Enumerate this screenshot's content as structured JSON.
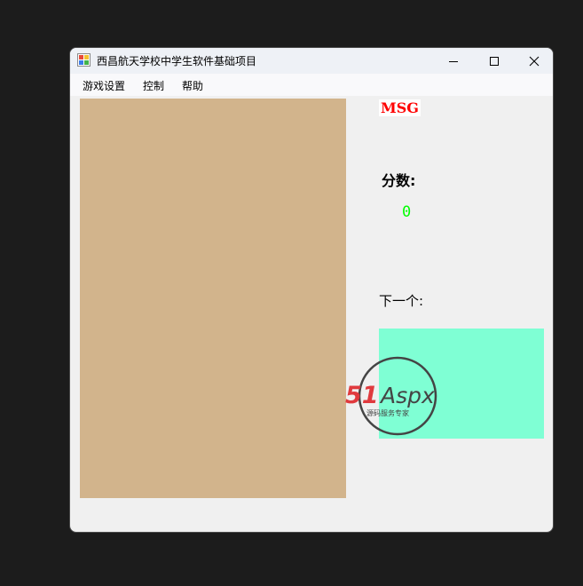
{
  "window": {
    "title": "西昌航天学校中学生软件基础项目",
    "icon": "app-icon",
    "controls": [
      "minimize-icon",
      "maximize-icon",
      "close-icon"
    ]
  },
  "menu": {
    "items": [
      {
        "label": "游戏设置"
      },
      {
        "label": "控制"
      },
      {
        "label": "帮助"
      }
    ]
  },
  "game": {
    "msg": "MSG",
    "score_label": "分数:",
    "score_value": "0",
    "next_label": "下一个:"
  },
  "watermark": {
    "brand": "51Aspx",
    "tagline": "源码服务专家"
  },
  "colors": {
    "board": "#d2b48c",
    "next_box": "#7fffd4",
    "msg_text": "#ff0000",
    "score_text": "#00ff00",
    "brand_red": "#e03a3e",
    "brand_green": "#3cb34a"
  }
}
